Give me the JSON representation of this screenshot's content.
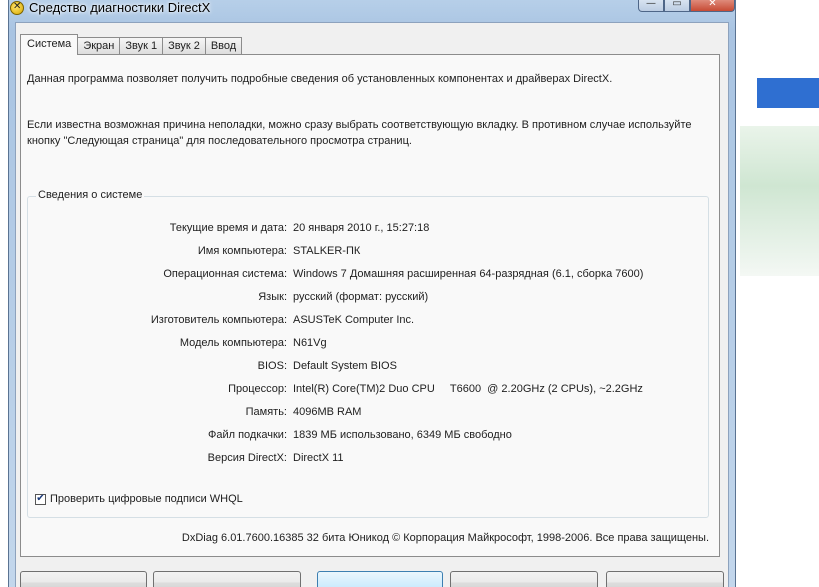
{
  "window": {
    "title": "Средство диагностики DirectX",
    "minimize_glyph": "—",
    "maximize_glyph": "▭",
    "close_glyph": "✕"
  },
  "tabs": [
    {
      "label": "Система",
      "active": true
    },
    {
      "label": "Экран",
      "active": false
    },
    {
      "label": "Звук 1",
      "active": false
    },
    {
      "label": "Звук 2",
      "active": false
    },
    {
      "label": "Ввод",
      "active": false
    }
  ],
  "intro": {
    "line1": "Данная программа позволяет получить подробные сведения об установленных компонентах и драйверах DirectX.",
    "line2": "Если известна возможная причина неполадки, можно сразу выбрать соответствующую вкладку. В противном случае используйте кнопку \"Следующая страница\" для последовательного просмотра страниц."
  },
  "system_info": {
    "group_title": "Сведения о системе",
    "rows": [
      {
        "label": "Текущие время и дата:",
        "value": "20 января 2010 г., 15:27:18"
      },
      {
        "label": "Имя компьютера:",
        "value": "STALKER-ПК"
      },
      {
        "label": "Операционная система:",
        "value": "Windows 7 Домашняя расширенная 64-разрядная (6.1, сборка 7600)"
      },
      {
        "label": "Язык:",
        "value": "русский (формат: русский)"
      },
      {
        "label": "Изготовитель компьютера:",
        "value": "ASUSTeK Computer Inc."
      },
      {
        "label": "Модель компьютера:",
        "value": "N61Vg"
      },
      {
        "label": "BIOS:",
        "value": "Default System BIOS"
      },
      {
        "label": "Процессор:",
        "value": "Intel(R) Core(TM)2 Duo CPU     T6600  @ 2.20GHz (2 CPUs), ~2.2GHz"
      },
      {
        "label": "Память:",
        "value": "4096MB RAM"
      },
      {
        "label": "Файл подкачки:",
        "value": "1839 МБ использовано, 6349 МБ свободно"
      },
      {
        "label": "Версия DirectX:",
        "value": "DirectX 11"
      }
    ]
  },
  "whql_checkbox": {
    "label": "Проверить цифровые подписи WHQL",
    "checked": true,
    "check_glyph": "✔"
  },
  "footer": "DxDiag 6.01.7600.16385 32 бита Юникод  © Корпорация Майкрософт, 1998-2006.  Все права защищены."
}
